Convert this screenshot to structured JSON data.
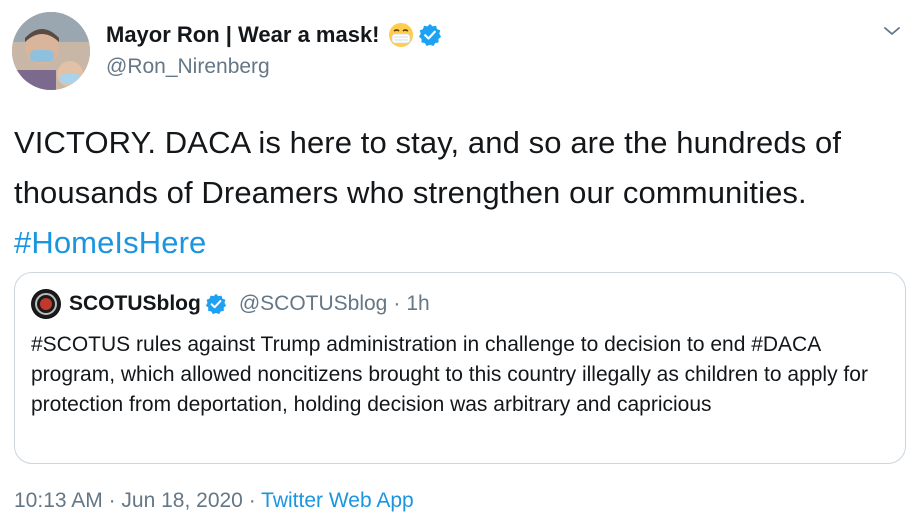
{
  "author": {
    "name": "Mayor Ron | Wear a mask!",
    "handle": "@Ron_Nirenberg",
    "avatar_icon": "profile-photo-avatar",
    "emoji_icon": "face-with-medical-mask-icon",
    "verified_icon": "verified-badge-icon"
  },
  "tweet": {
    "text": "VICTORY. DACA is here to stay, and so are the hundreds of thousands of Dreamers who strengthen our communities.",
    "hashtag": "#HomeIsHere"
  },
  "quote": {
    "name": "SCOTUSblog",
    "handle": "@SCOTUSblog",
    "separator": "·",
    "time": "1h",
    "text": "#SCOTUS rules against Trump administration in challenge to decision to end #DACA program, which allowed noncitizens brought to this country illegally as children to apply for protection from deportation, holding decision was arbitrary and capricious"
  },
  "meta": {
    "time": "10:13 AM",
    "separator1": "·",
    "date": "Jun 18, 2020",
    "separator2": "·",
    "source": "Twitter Web App"
  },
  "colors": {
    "link": "#1b95e0",
    "secondary_text": "#657786",
    "primary_text": "#14171a",
    "border": "#ccd6dd"
  }
}
